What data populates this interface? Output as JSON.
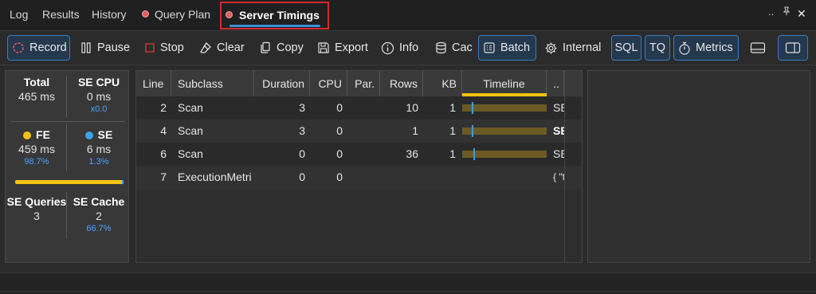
{
  "tabs": [
    "Log",
    "Results",
    "History",
    "Query Plan",
    "Server Timings"
  ],
  "window_controls": {
    "overflow": "‥",
    "pin": "†",
    "close": "✕"
  },
  "toolbar": {
    "record": "Record",
    "pause": "Pause",
    "stop": "Stop",
    "clear": "Clear",
    "copy": "Copy",
    "export": "Export",
    "info": "Info",
    "cache": "Cac",
    "batch": "Batch",
    "internal": "Internal",
    "sql": "SQL",
    "tq": "TQ",
    "metrics": "Metrics"
  },
  "stats": {
    "total": {
      "label": "Total",
      "value": "465 ms"
    },
    "se_cpu": {
      "label": "SE CPU",
      "value": "0 ms",
      "sub": "x0.0"
    },
    "fe": {
      "label": "FE",
      "value": "459 ms",
      "sub": "98.7%"
    },
    "se": {
      "label": "SE",
      "value": "6 ms",
      "sub": "1.3%"
    },
    "se_queries": {
      "label": "SE Queries",
      "value": "3"
    },
    "se_cache": {
      "label": "SE Cache",
      "value": "2",
      "sub": "66.7%"
    },
    "fe_fraction": 0.987
  },
  "grid": {
    "columns": [
      "Line",
      "Subclass",
      "Duration",
      "CPU",
      "Par.",
      "Rows",
      "KB",
      "Timeline",
      ".."
    ],
    "rows": [
      {
        "line": "2",
        "subclass": "Scan",
        "duration": "3",
        "cpu": "0",
        "par": "",
        "rows": "10",
        "kb": "1",
        "query": "SE",
        "query_bold": false,
        "tl_mark": 0.11
      },
      {
        "line": "4",
        "subclass": "Scan",
        "duration": "3",
        "cpu": "0",
        "par": "",
        "rows": "1",
        "kb": "1",
        "query": "SE",
        "query_bold": true,
        "tl_mark": 0.11
      },
      {
        "line": "6",
        "subclass": "Scan",
        "duration": "0",
        "cpu": "0",
        "par": "",
        "rows": "36",
        "kb": "1",
        "query": "SE",
        "query_bold": false,
        "tl_mark": 0.13
      },
      {
        "line": "7",
        "subclass": "ExecutionMetri",
        "duration": "0",
        "cpu": "0",
        "par": "",
        "rows": "",
        "kb": "",
        "query": "{ \"t",
        "query_bold": false,
        "tl_mark": null
      }
    ]
  },
  "colors": {
    "accent": "#3d7bbf",
    "record_red": "#e25c5c",
    "fe_yellow": "#f2c310",
    "se_blue": "#38a4e8",
    "highlight_red": "#d42a2a"
  }
}
